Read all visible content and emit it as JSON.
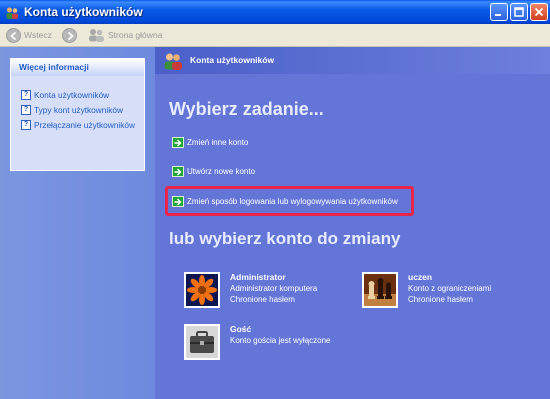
{
  "window": {
    "title": "Konta użytkowników"
  },
  "toolbar": {
    "back_label": "Wstecz",
    "home_label": "Strona główna"
  },
  "sidebar": {
    "title": "Więcej informacji",
    "items": [
      {
        "label": "Konta użytkowników",
        "icon": "help-icon"
      },
      {
        "label": "Typy kont użytkowników",
        "icon": "help-icon"
      },
      {
        "label": "Przełączanie użytkowników",
        "icon": "help-icon"
      }
    ]
  },
  "main": {
    "header_title": "Konta użytkowników",
    "pick_task_heading": "Wybierz zadanie...",
    "tasks": [
      {
        "label": "Zmień inne konto"
      },
      {
        "label": "Utwórz nowe konto"
      },
      {
        "label": "Zmień sposób logowania lub wylogowywania użytkowników"
      }
    ],
    "pick_account_heading": "lub wybierz konto do zmiany",
    "accounts": [
      {
        "name": "Administrator",
        "line1": "Administrator komputera",
        "line2": "Chronione hasłem",
        "picture": "flower"
      },
      {
        "name": "uczen",
        "line1": "Konto z ograniczeniami",
        "line2": "Chronione hasłem",
        "picture": "chess"
      },
      {
        "name": "Gość",
        "line1": "Konto gościa jest wyłączone",
        "line2": "",
        "picture": "briefcase"
      }
    ]
  },
  "colors": {
    "highlight": "#e8254a",
    "main_bg": "#6375d6",
    "link": "#215dc6"
  }
}
